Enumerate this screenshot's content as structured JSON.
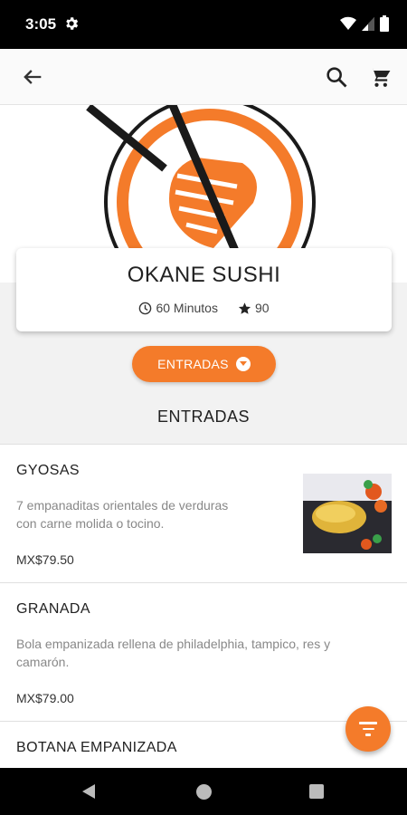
{
  "status_bar": {
    "time": "3:05"
  },
  "toolbar": {
    "back_icon": "arrow-left-icon",
    "search_icon": "search-icon",
    "cart_icon": "cart-icon"
  },
  "restaurant": {
    "name": "OKANE SUSHI",
    "delivery_time": "60 Minutos",
    "rating": "90"
  },
  "category_button": {
    "label": "ENTRADAS"
  },
  "section": {
    "title": "ENTRADAS"
  },
  "menu_items": [
    {
      "name": "GYOSAS",
      "description_line1": "7 empanaditas orientales de verduras",
      "description_line2": "con carne molida o tocino.",
      "price": "MX$79.50"
    },
    {
      "name": "GRANADA",
      "description_line1": "Bola empanizada rellena de philadelphia, tampico, res y",
      "description_line2": "camarón.",
      "price": "MX$79.00"
    },
    {
      "name": "BOTANA EMPANIZADA"
    }
  ],
  "colors": {
    "accent": "#f47b2a",
    "logo_dark": "#1a1a1a"
  }
}
